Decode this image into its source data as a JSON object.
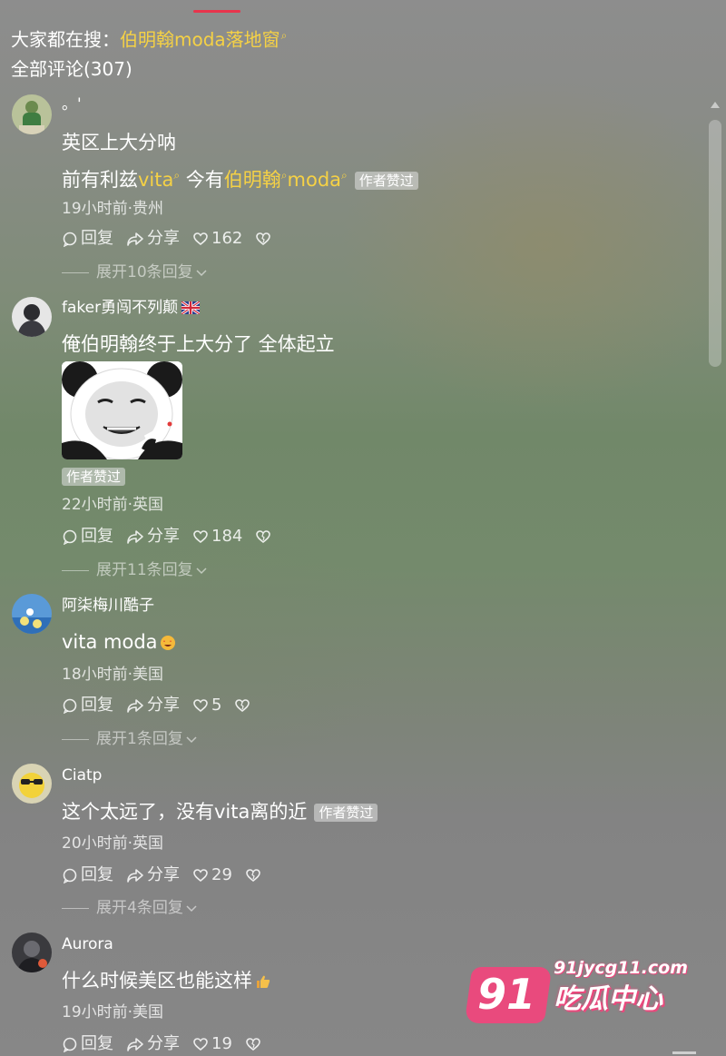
{
  "header": {
    "search_prefix": "大家都在搜：",
    "search_term": "伯明翰moda落地窗",
    "search_icon": "search-icon",
    "all_comments_label": "全部评论(307)"
  },
  "actions": {
    "reply_label": "回复",
    "share_label": "分享"
  },
  "comments": [
    {
      "username": "。'",
      "line1": "英区上大分呐",
      "line2_prefix": "前有利兹",
      "line2_link1": "vita",
      "line2_mid": " 今有",
      "line2_link2": "伯明翰",
      "line2_link3": "moda",
      "author_tag": "作者赞过",
      "meta": "19小时前·贵州",
      "likes": "162",
      "expand": "展开10条回复"
    },
    {
      "username": "faker勇闯不列颠",
      "flag_icon": "uk-flag-icon",
      "line1": "俺伯明翰终于上大分了 全体起立",
      "sticker": "panda-meme-sticker",
      "author_tag": "作者赞过",
      "meta": "22小时前·英国",
      "likes": "184",
      "expand": "展开11条回复"
    },
    {
      "username": "阿柒梅川酷子",
      "line1": "vita moda",
      "emoji": "star-eyes-emoji",
      "meta": "18小时前·美国",
      "likes": "5",
      "expand": "展开1条回复"
    },
    {
      "username": "Ciatp",
      "line1": "这个太远了，没有vita离的近",
      "author_tag": "作者赞过",
      "meta": "20小时前·英国",
      "likes": "29",
      "expand": "展开4条回复"
    },
    {
      "username": "Aurora",
      "line1": "什么时候美区也能这样",
      "emoji": "thumbs-up-emoji",
      "meta": "19小时前·美国",
      "likes": "19"
    }
  ],
  "watermark": {
    "number": "91",
    "url": "91jycg11.com",
    "text": "吃瓜中心",
    "brand_color": "#e94a7d"
  },
  "colors": {
    "highlight": "#f5d145",
    "tab_indicator": "#e8344c"
  }
}
